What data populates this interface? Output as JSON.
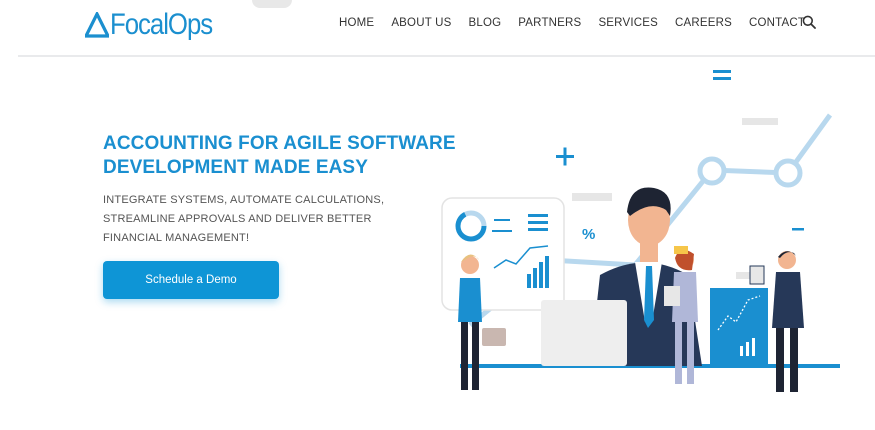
{
  "brand": {
    "name": "FocalOps",
    "color": "#1b8fcf"
  },
  "nav": {
    "items": [
      "HOME",
      "ABOUT US",
      "BLOG",
      "PARTNERS",
      "SERVICES",
      "CAREERS",
      "CONTACT"
    ],
    "search_icon": "search-icon"
  },
  "hero": {
    "title_line1": "ACCOUNTING FOR AGILE SOFTWARE",
    "title_line2": "DEVELOPMENT MADE EASY",
    "subtitle_line1": "INTEGRATE SYSTEMS, AUTOMATE CALCULATIONS,",
    "subtitle_line2": "STREAMLINE APPROVALS AND DELIVER BETTER",
    "subtitle_line3": "FINANCIAL MANAGEMENT!",
    "cta_label": "Schedule a Demo",
    "accent": "#0e95d6"
  },
  "illustration": {
    "percent_label": "%"
  }
}
